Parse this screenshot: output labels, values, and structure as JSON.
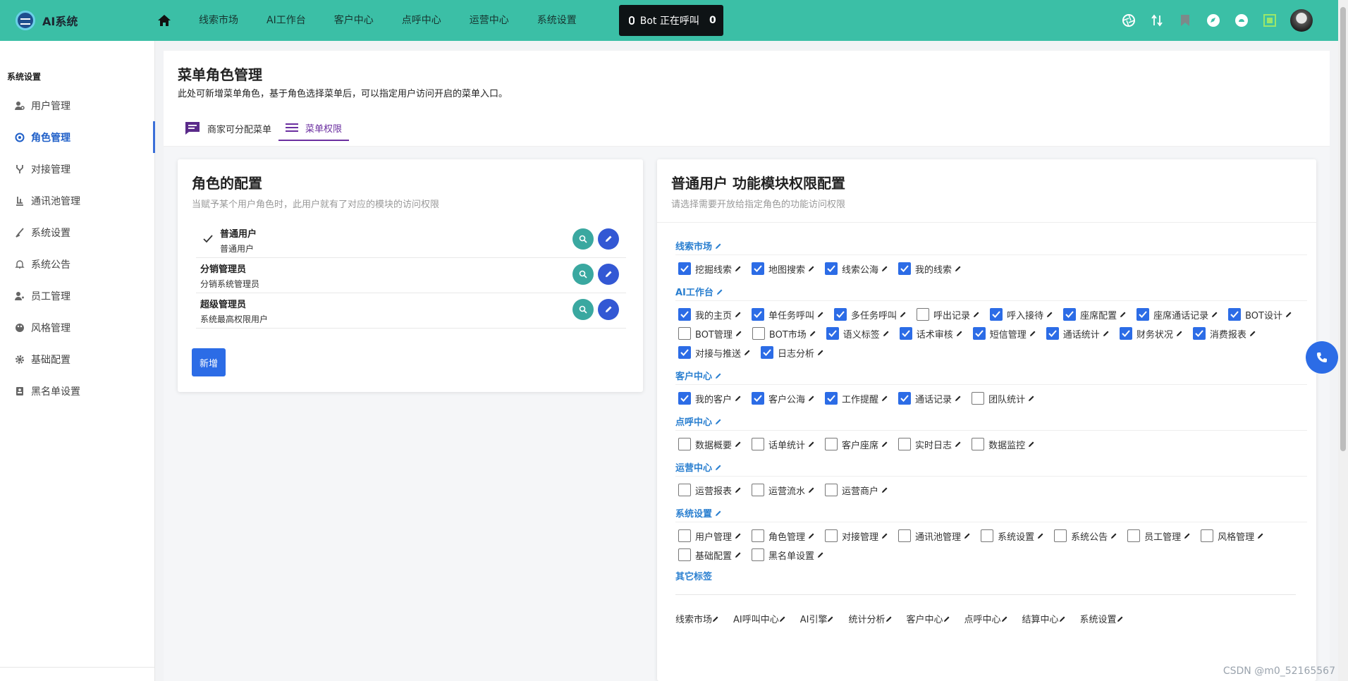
{
  "header": {
    "logo_text": "AI系统",
    "nav": [
      "线索市场",
      "AI工作台",
      "客户中心",
      "点呼中心",
      "运营中心",
      "系统设置"
    ],
    "bot_label": "Bot 正在呼叫",
    "bot_count": "0"
  },
  "sidebar": {
    "title": "系统设置",
    "items": [
      {
        "label": "用户管理",
        "icon": "user-gear-icon",
        "active": false
      },
      {
        "label": "角色管理",
        "icon": "role-icon",
        "active": true
      },
      {
        "label": "对接管理",
        "icon": "fork-icon",
        "active": false
      },
      {
        "label": "通讯池管理",
        "icon": "pool-icon",
        "active": false
      },
      {
        "label": "系统设置",
        "icon": "brush-icon",
        "active": false
      },
      {
        "label": "系统公告",
        "icon": "bell-icon",
        "active": false
      },
      {
        "label": "员工管理",
        "icon": "staff-icon",
        "active": false
      },
      {
        "label": "风格管理",
        "icon": "palette-icon",
        "active": false
      },
      {
        "label": "基础配置",
        "icon": "gear-icon",
        "active": false
      },
      {
        "label": "黑名单设置",
        "icon": "contact-icon",
        "active": false
      }
    ]
  },
  "page": {
    "title": "菜单角色管理",
    "desc": "此处可新增菜单角色，基于角色选择菜单后，可以指定用户访问开启的菜单入口。",
    "tabs": [
      "商家可分配菜单",
      "菜单权限"
    ]
  },
  "roles_card": {
    "title": "角色的配置",
    "subtitle": "当赋予某个用户角色时，此用户就有了对应的模块的访问权限",
    "roles": [
      {
        "name": "普通用户",
        "desc": "普通用户",
        "selected": true
      },
      {
        "name": "分销管理员",
        "desc": "分销系统管理员",
        "selected": false
      },
      {
        "name": "超级管理员",
        "desc": "系统最高权限用户",
        "selected": false
      }
    ],
    "new_label": "新增"
  },
  "perm_card": {
    "title": "普通用户 功能模块权限配置",
    "subtitle": "请选择需要开放给指定角色的功能访问权限",
    "sections": [
      {
        "title": "线索市场",
        "items": [
          {
            "label": "挖掘线索",
            "checked": true
          },
          {
            "label": "地图搜索",
            "checked": true
          },
          {
            "label": "线索公海",
            "checked": true
          },
          {
            "label": "我的线索",
            "checked": true
          }
        ]
      },
      {
        "title": "AI工作台",
        "items": [
          {
            "label": "我的主页",
            "checked": true
          },
          {
            "label": "单任务呼叫",
            "checked": true
          },
          {
            "label": "多任务呼叫",
            "checked": true
          },
          {
            "label": "呼出记录",
            "checked": false
          },
          {
            "label": "呼入接待",
            "checked": true
          },
          {
            "label": "座席配置",
            "checked": true
          },
          {
            "label": "座席通话记录",
            "checked": true
          },
          {
            "label": "BOT设计",
            "checked": true
          },
          {
            "label": "BOT管理",
            "checked": false
          },
          {
            "label": "BOT市场",
            "checked": false
          },
          {
            "label": "语义标签",
            "checked": true
          },
          {
            "label": "话术审核",
            "checked": true
          },
          {
            "label": "短信管理",
            "checked": true
          },
          {
            "label": "通话统计",
            "checked": true
          },
          {
            "label": "财务状况",
            "checked": true
          },
          {
            "label": "消费报表",
            "checked": true
          },
          {
            "label": "对接与推送",
            "checked": true
          },
          {
            "label": "日志分析",
            "checked": true
          }
        ]
      },
      {
        "title": "客户中心",
        "items": [
          {
            "label": "我的客户",
            "checked": true
          },
          {
            "label": "客户公海",
            "checked": true
          },
          {
            "label": "工作提醒",
            "checked": true
          },
          {
            "label": "通话记录",
            "checked": true
          },
          {
            "label": "团队统计",
            "checked": false
          }
        ]
      },
      {
        "title": "点呼中心",
        "items": [
          {
            "label": "数据概要",
            "checked": false
          },
          {
            "label": "话单统计",
            "checked": false
          },
          {
            "label": "客户座席",
            "checked": false
          },
          {
            "label": "实时日志",
            "checked": false
          },
          {
            "label": "数据监控",
            "checked": false
          }
        ]
      },
      {
        "title": "运营中心",
        "items": [
          {
            "label": "运营报表",
            "checked": false
          },
          {
            "label": "运营流水",
            "checked": false
          },
          {
            "label": "运营商户",
            "checked": false
          }
        ]
      },
      {
        "title": "系统设置",
        "items": [
          {
            "label": "用户管理",
            "checked": false
          },
          {
            "label": "角色管理",
            "checked": false
          },
          {
            "label": "对接管理",
            "checked": false
          },
          {
            "label": "通讯池管理",
            "checked": false
          },
          {
            "label": "系统设置",
            "checked": false
          },
          {
            "label": "系统公告",
            "checked": false
          },
          {
            "label": "员工管理",
            "checked": false
          },
          {
            "label": "风格管理",
            "checked": false
          },
          {
            "label": "基础配置",
            "checked": false
          },
          {
            "label": "黑名单设置",
            "checked": false
          }
        ]
      }
    ],
    "other_title": "其它标签",
    "other_tags": [
      "线索市场",
      "AI呼叫中心",
      "AI引擎",
      "统计分析",
      "客户中心",
      "点呼中心",
      "结算中心",
      "系统设置"
    ]
  },
  "watermark": "CSDN @m0_52165567",
  "colors": {
    "header": "#3bbfa6",
    "accent": "#2c6ce6",
    "section": "#2a7fd0",
    "tab_active": "#6b2fa0"
  }
}
